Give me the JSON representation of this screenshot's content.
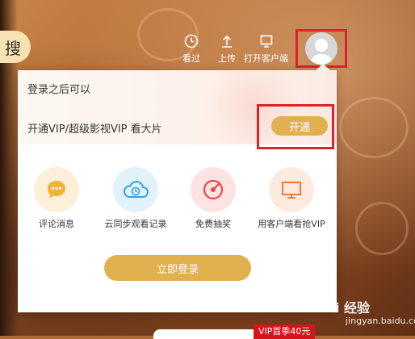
{
  "search": {
    "label": "搜"
  },
  "toolbar": {
    "history_label": "看过",
    "upload_label": "上传",
    "client_label": "打开客户端"
  },
  "panel": {
    "login_hint": "登录之后可以",
    "vip_text": "开通VIP/超级影视VIP 看大片",
    "open_label": "开通",
    "features": [
      {
        "label": "评论消息",
        "icon": "comment-icon"
      },
      {
        "label": "云同步观看记录",
        "icon": "cloud-sync-icon"
      },
      {
        "label": "免费抽奖",
        "icon": "lottery-icon"
      },
      {
        "label": "用客户端看抢VIP",
        "icon": "tv-icon"
      }
    ],
    "login_button": "立即登录"
  },
  "promo": {
    "vip_badge": "VIP首季40元"
  },
  "watermark": {
    "brand": "Bai 经验",
    "url": "jingyan.baidu.com"
  },
  "colors": {
    "accent": "#e1b14f",
    "highlight": "#e0202a",
    "badge": "#d7141a"
  }
}
